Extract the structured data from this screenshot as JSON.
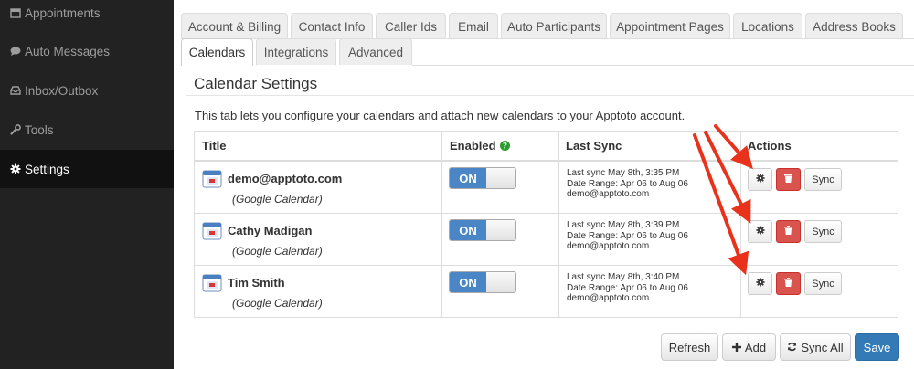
{
  "sidebar": {
    "items": [
      {
        "label": "Appointments",
        "icon": "calendar-icon"
      },
      {
        "label": "Auto Messages",
        "icon": "speech-bubble-icon"
      },
      {
        "label": "Inbox/Outbox",
        "icon": "inbox-icon"
      },
      {
        "label": "Tools",
        "icon": "wrench-icon"
      },
      {
        "label": "Settings",
        "icon": "gear-icon",
        "active": true
      }
    ]
  },
  "tabs": {
    "row1": [
      "Account & Billing",
      "Contact Info",
      "Caller Ids",
      "Email",
      "Auto Participants",
      "Appointment Pages",
      "Locations",
      "Address Books"
    ],
    "row2": [
      "Calendars",
      "Integrations",
      "Advanced"
    ],
    "active": "Calendars"
  },
  "section": {
    "title": "Calendar Settings",
    "description": "This tab lets you configure your calendars and attach new calendars to your Apptoto account."
  },
  "table": {
    "headers": {
      "title": "Title",
      "enabled": "Enabled",
      "last_sync": "Last Sync",
      "actions": "Actions"
    },
    "rows": [
      {
        "name": "demo@apptoto.com",
        "type": "(Google Calendar)",
        "enabled": "ON",
        "sync_line1": "Last sync May 8th, 3:35 PM",
        "sync_line2": "Date Range: Apr 06 to Aug 06",
        "sync_line3": "demo@apptoto.com",
        "sync_button": "Sync"
      },
      {
        "name": "Cathy Madigan",
        "type": "(Google Calendar)",
        "enabled": "ON",
        "sync_line1": "Last sync May 8th, 3:39 PM",
        "sync_line2": "Date Range: Apr 06 to Aug 06",
        "sync_line3": "demo@apptoto.com",
        "sync_button": "Sync"
      },
      {
        "name": "Tim Smith",
        "type": "(Google Calendar)",
        "enabled": "ON",
        "sync_line1": "Last sync May 8th, 3:40 PM",
        "sync_line2": "Date Range: Apr 06 to Aug 06",
        "sync_line3": "demo@apptoto.com",
        "sync_button": "Sync"
      }
    ]
  },
  "footer": {
    "refresh": "Refresh",
    "add": "Add",
    "sync_all": "Sync All",
    "save": "Save"
  },
  "colors": {
    "sidebar_bg": "#222222",
    "toggle_on": "#4a86c6",
    "delete": "#d9534f",
    "primary": "#337ab7",
    "annotation_arrow": "#e8321c",
    "help_icon": "#2a9d2a"
  }
}
